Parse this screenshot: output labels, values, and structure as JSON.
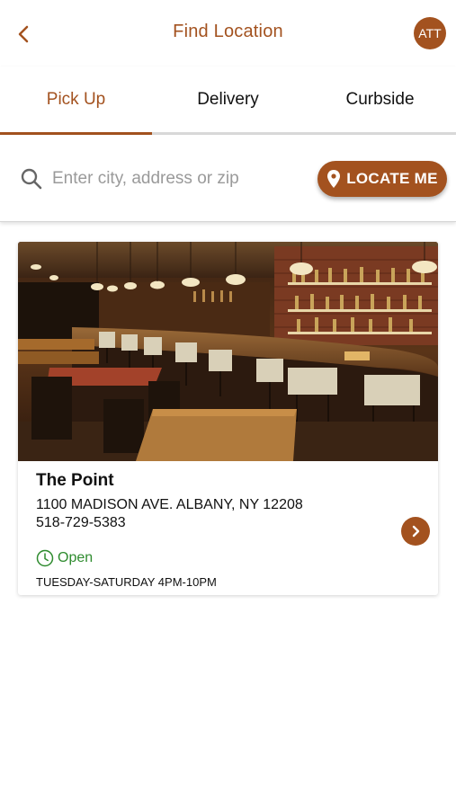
{
  "header": {
    "title": "Find Location",
    "avatar_initials": "ATT",
    "back_icon": "chevron-left-icon"
  },
  "tabs": [
    {
      "label": "Pick Up",
      "active": true
    },
    {
      "label": "Delivery",
      "active": false
    },
    {
      "label": "Curbside",
      "active": false
    }
  ],
  "search": {
    "placeholder": "Enter city, address or zip",
    "value": "",
    "locate_label": "LOCATE ME"
  },
  "locations": [
    {
      "name": "The Point",
      "address": "1100 MADISON AVE. ALBANY, NY 12208",
      "phone": "518-729-5383",
      "status": "Open",
      "hours": "TUESDAY-SATURDAY 4PM-10PM"
    }
  ],
  "colors": {
    "accent": "#a3521f",
    "open_green": "#2e8b2e"
  }
}
